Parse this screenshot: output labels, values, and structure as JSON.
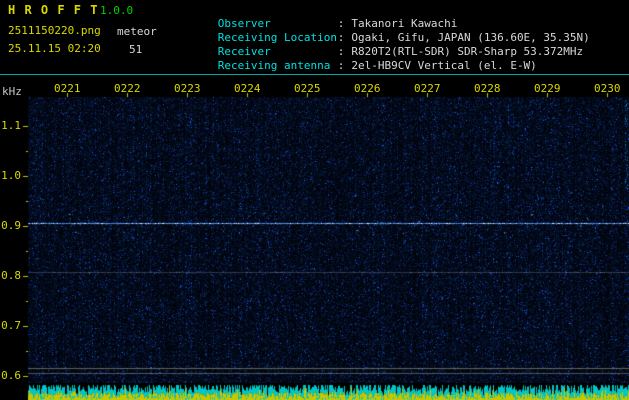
{
  "header": {
    "app_title": "H R O F F T",
    "version": "1.0.0",
    "filename": "2511150220.png",
    "mode": "meteor",
    "datetime": "25.11.15 02:20",
    "count": "51",
    "colon": ":",
    "info": [
      {
        "label": "Observer",
        "value": "Takanori Kawachi"
      },
      {
        "label": "Receiving Location",
        "value": "Ogaki, Gifu, JAPAN (136.60E, 35.35N)"
      },
      {
        "label": "Receiver",
        "value": "R820T2(RTL-SDR) SDR-Sharp 53.372MHz"
      },
      {
        "label": "Receiving antenna",
        "value": "2el-HB9CV Vertical (el. E-W)"
      }
    ]
  },
  "colors": {
    "title": "#d8d800",
    "version": "#00d000",
    "info_label": "#00e0e0",
    "info_value": "#d8d8d8",
    "axis_label": "#d8d800",
    "unit_label": "#c8c8c8",
    "separator": "#00a8a8",
    "background": "#000000"
  },
  "chart_data": {
    "type": "heatmap",
    "title": "",
    "xlabel": "",
    "ylabel": "kHz",
    "x_ticks": [
      "0221",
      "0222",
      "0223",
      "0224",
      "0225",
      "0226",
      "0227",
      "0228",
      "0229",
      "0230"
    ],
    "y_unit": "kHz",
    "y_ticks": [
      "1.1",
      "1.0",
      "0.9",
      "0.8",
      "0.7",
      "0.6"
    ],
    "y_range_khz": [
      0.59,
      1.16
    ],
    "grid": false,
    "features": {
      "carrier_line_khz": 0.905,
      "faint_line_khz": 0.808,
      "baseline_lines_khz": [
        0.617,
        0.607
      ],
      "right_edge_interference": true,
      "background_noise": "sparse dark-blue speckle noise",
      "bottom_strip": "per-column signal-level bars, yellow baseline with cyan overlay"
    },
    "palette": {
      "noise_bright": "#3c78d2",
      "carrier": "rgba(90,160,255,0.9)",
      "carrier_peak": "rgba(240,250,255,0.95)",
      "strip_cyan": "#00c8c8",
      "strip_yellow": "#c8c800",
      "tick": "#c8c800"
    }
  }
}
